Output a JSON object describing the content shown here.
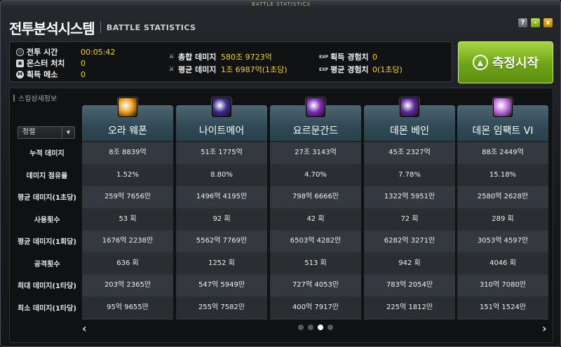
{
  "window": {
    "top_caption": "BATTLE STATISTICS",
    "title_ko": "전투분석시스템",
    "title_en": "BATTLE STATISTICS",
    "help": "?",
    "minimize": "-",
    "close": "x"
  },
  "stats": {
    "time_label": "전투 시간",
    "time_value": "00:05:42",
    "monster_label": "몬스터 처치",
    "monster_value": "0",
    "meso_label": "획득 메소",
    "meso_value": "0",
    "total_damage_label": "총합 데미지",
    "total_damage_value": "580조 9723억",
    "avg_damage_label": "평균 데미지",
    "avg_damage_value": "1조 6987억(1초당)",
    "exp_label": "획득 경험치",
    "exp_value": "0",
    "avg_exp_label": "평균 경험치",
    "avg_exp_value": "0(1초당)",
    "exp_tag": "EXP",
    "meso_tag": "M",
    "box_tag": "▣"
  },
  "start_button": {
    "label": "측정시작"
  },
  "detail": {
    "title": "스킬상세정보",
    "dropdown_value": "정렬",
    "row_labels": [
      "누적 데미지",
      "데미지 점유율",
      "평균 데미지(1초당)",
      "사용횟수",
      "평균 데미지(1회당)",
      "공격횟수",
      "최대 데미지(1타당)",
      "최소 데미지(1타당)"
    ]
  },
  "skills": [
    {
      "name": "오라 웨폰",
      "icon": "aura-weapon-icon",
      "color": "#f0a020",
      "values": [
        "8조 8839억",
        "1.52%",
        "259억 7656만",
        "53 회",
        "1676억 2238만",
        "636 회",
        "203억 2365만",
        "95억 9655만"
      ]
    },
    {
      "name": "나이트메어",
      "icon": "nightmare-icon",
      "color": "#3b2a8c",
      "values": [
        "51조 1775억",
        "8.80%",
        "1496억 4195만",
        "92 회",
        "5562억 7769만",
        "1252 회",
        "547억 5949만",
        "255억 7582만"
      ]
    },
    {
      "name": "요르문간드",
      "icon": "jormungand-icon",
      "color": "#7a2fb0",
      "values": [
        "27조 3143억",
        "4.70%",
        "798억 6666만",
        "42 회",
        "6503억 4282만",
        "513 회",
        "727억 4053만",
        "400억 7917만"
      ]
    },
    {
      "name": "데몬 베인",
      "icon": "demon-bane-icon",
      "color": "#5a2a9a",
      "values": [
        "45조 2327억",
        "7.78%",
        "1322억 5951만",
        "72 회",
        "6282억 3271만",
        "942 회",
        "783억 2054만",
        "225억 1812만"
      ]
    },
    {
      "name": "데몬 임팩트 VI",
      "icon": "demon-impact-icon",
      "color": "#c070e0",
      "values": [
        "88조 2449억",
        "15.18%",
        "2580억 2628만",
        "289 회",
        "3053억 4597만",
        "4046 회",
        "310억 7080만",
        "151억 1524만"
      ]
    }
  ],
  "pager": {
    "prev": "‹",
    "next": "›",
    "pages": 4,
    "active": 2
  }
}
